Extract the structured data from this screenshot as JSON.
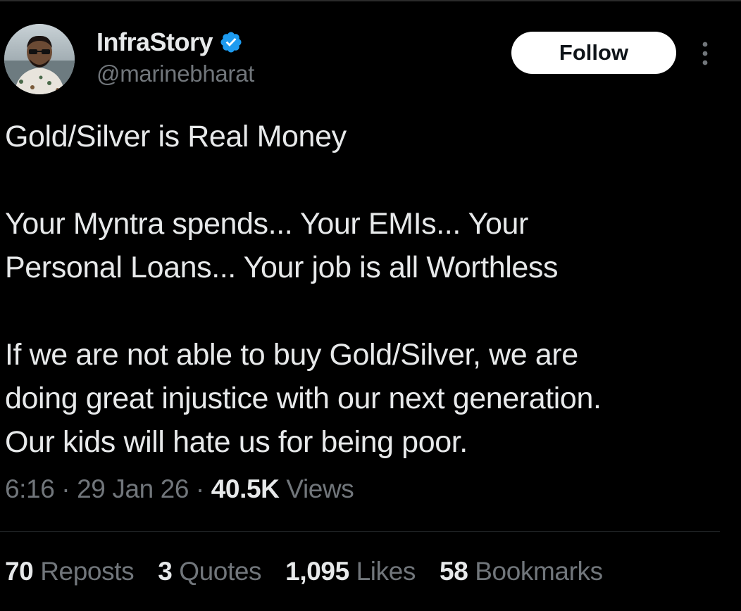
{
  "author": {
    "display_name": "InfraStory",
    "handle": "@marinebharat",
    "verified": true
  },
  "follow_button": {
    "label": "Follow"
  },
  "tweet": {
    "paragraphs": [
      "Gold/Silver is Real Money",
      "Your Myntra spends... Your EMIs... Your\nPersonal Loans... Your job is all Worthless",
      "If we are not able to buy Gold/Silver, we are\ndoing great injustice with our next generation.\nOur kids will hate us for being poor."
    ]
  },
  "meta": {
    "time": "6:16",
    "sep1": " · ",
    "date": "29 Jan 26",
    "sep2": " · ",
    "views_count": "40.5K",
    "views_label": " Views"
  },
  "stats": {
    "reposts": {
      "count": "70",
      "label": " Reposts"
    },
    "quotes": {
      "count": "3",
      "label": " Quotes"
    },
    "likes": {
      "count": "1,095",
      "label": " Likes"
    },
    "bookmarks": {
      "count": "58",
      "label": " Bookmarks"
    }
  },
  "colors": {
    "background": "#000000",
    "primary_text": "#e7e9ea",
    "secondary_text": "#71767b",
    "verified_blue": "#1d9bf0",
    "follow_bg": "#ffffff",
    "divider": "#2f3336"
  },
  "icons": {
    "verified": "verified-badge-icon",
    "more": "more-options-icon"
  }
}
